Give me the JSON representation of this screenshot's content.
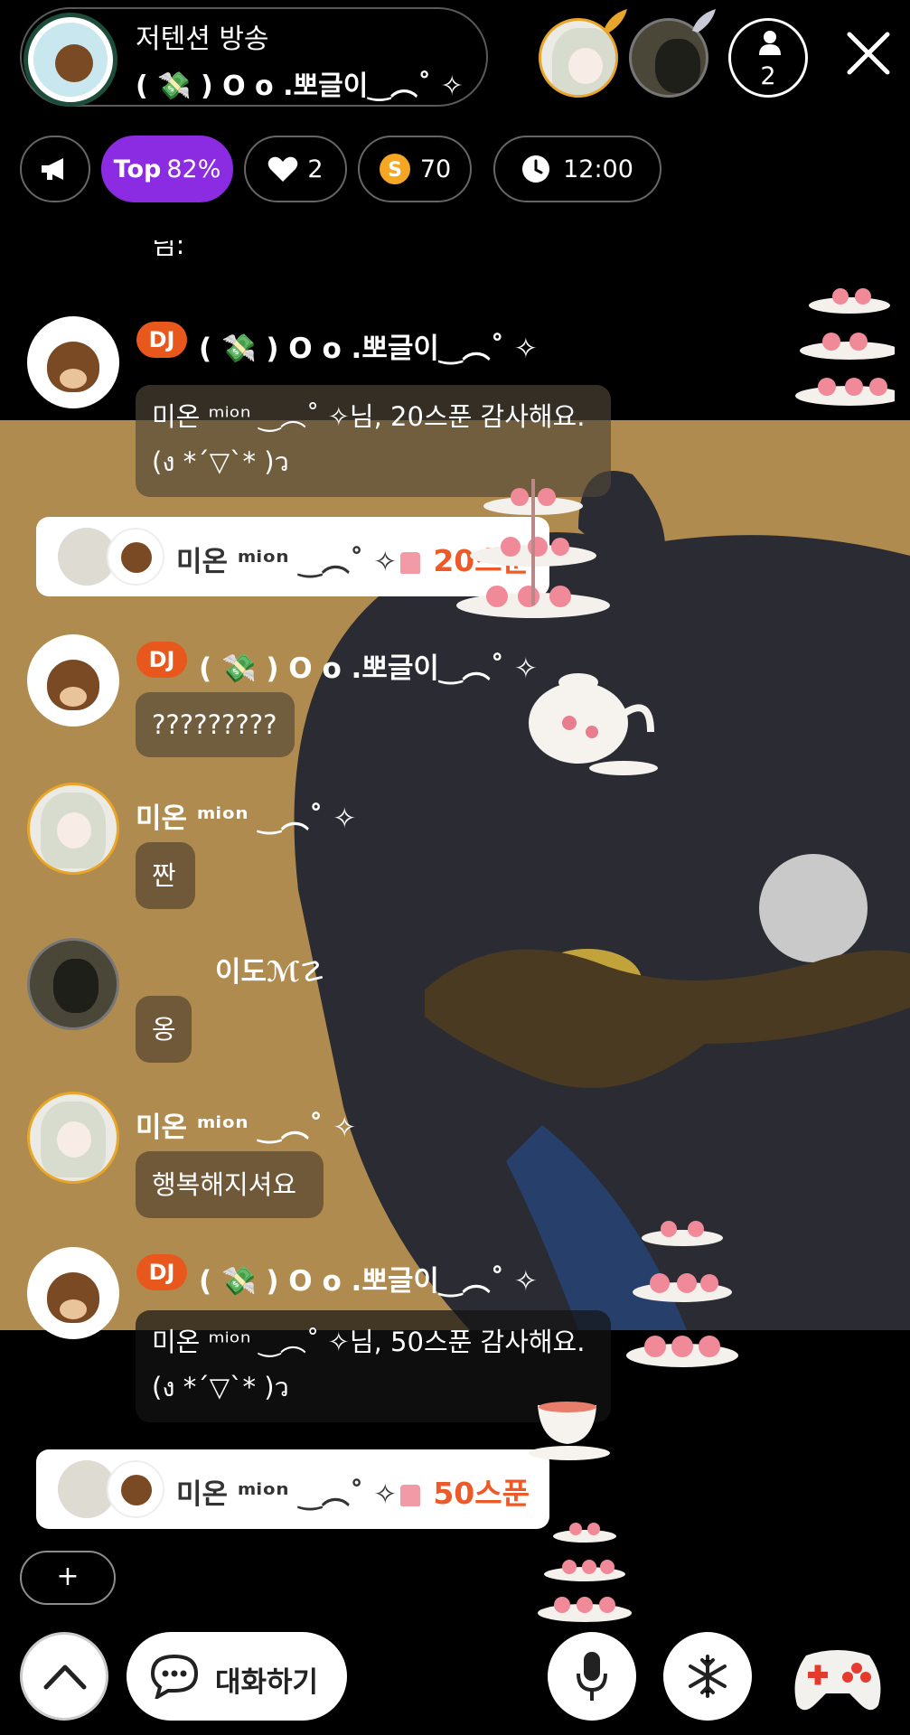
{
  "header": {
    "title": "저텐션 방송",
    "host_name": "( 💸 ) O o .뽀글이‿︵˚ ✧",
    "listener_count": "2"
  },
  "stats": {
    "top_prefix": "Top",
    "top_value": "82%",
    "likes": "2",
    "spoons": "70",
    "time": "12:00"
  },
  "chat": {
    "partial_top": "님:",
    "messages": [
      {
        "type": "dj",
        "name": "( 💸 ) O o .뽀글이‿︵˚ ✧",
        "badge": "DJ",
        "line1": "미온 ᵐⁱᵒⁿ ‿︵˚ ✧님, 20스푼 감사해요.",
        "line2": "(ง *´▽`* )ว"
      },
      {
        "type": "gift",
        "name": "미온 ᵐⁱᵒⁿ ‿︵˚ ✧",
        "amount": "20스푼"
      },
      {
        "type": "dj",
        "name": "( 💸 ) O o .뽀글이‿︵˚ ✧",
        "badge": "DJ",
        "text": "?????????"
      },
      {
        "type": "user",
        "name": "미온 ᵐⁱᵒⁿ ‿︵˚ ✧",
        "text": "짠"
      },
      {
        "type": "user",
        "name": "이도ℳ☡",
        "text": "옹"
      },
      {
        "type": "user",
        "name": "미온 ᵐⁱᵒⁿ ‿︵˚ ✧",
        "text": "행복해지셔요"
      },
      {
        "type": "dj",
        "name": "( 💸 ) O o .뽀글이‿︵˚ ✧",
        "badge": "DJ",
        "line1": "미온 ᵐⁱᵒⁿ ‿︵˚ ✧님, 50스푼 감사해요.",
        "line2": "(ง *´▽`* )ว"
      },
      {
        "type": "gift",
        "name": "미온 ᵐⁱᵒⁿ ‿︵˚ ✧",
        "amount": "50스푼"
      }
    ]
  },
  "controls": {
    "plus_label": "+",
    "chat_label": "대화하기"
  },
  "icons": {
    "megaphone": "megaphone-icon",
    "heart": "heart-icon",
    "spoon": "spoon-icon",
    "clock": "clock-icon",
    "person": "person-icon",
    "close": "close-icon",
    "chevron": "chevron-up-icon",
    "chat": "chat-bubble-icon",
    "mic": "microphone-icon",
    "freeze": "snowflake-icon",
    "game": "game-controller-icon"
  },
  "colors": {
    "top_pill": "#8b2be2",
    "dj_badge": "#e8571c",
    "gift_amount": "#ec5a2a",
    "spoon_coin": "#f5a623"
  }
}
